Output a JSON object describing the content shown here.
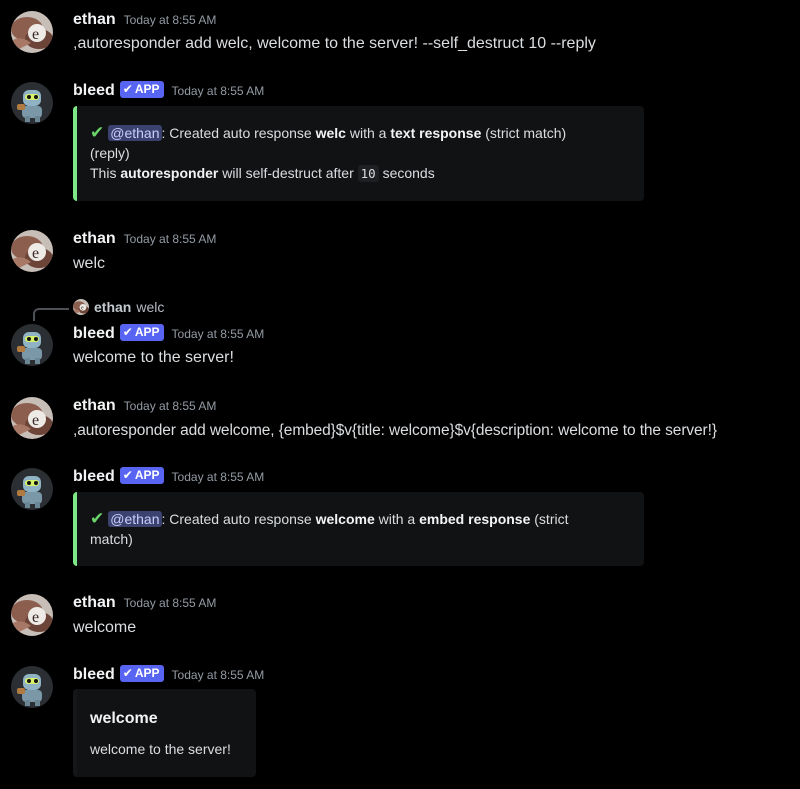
{
  "users": {
    "ethan": {
      "name": "ethan"
    },
    "bleed": {
      "name": "bleed",
      "badge": "APP"
    }
  },
  "messages": [
    {
      "author": "ethan",
      "time": "Today at 8:55 AM",
      "text": ",autoresponder add welc, welcome to the server! --self_destruct 10 --reply"
    },
    {
      "author": "bleed",
      "time": "Today at 8:55 AM",
      "embed": {
        "mention": "@ethan",
        "line1_a": ": Created auto response ",
        "line1_b": "welc",
        "line1_c": " with a ",
        "line1_d": "text response",
        "line1_e": " (strict match)",
        "line2": "(reply)",
        "line3_a": "This ",
        "line3_b": "autoresponder",
        "line3_c": " will self-destruct after ",
        "line3_d": "10",
        "line3_e": " seconds"
      }
    },
    {
      "author": "ethan",
      "time": "Today at 8:55 AM",
      "text": "welc"
    },
    {
      "author": "bleed",
      "time": "Today at 8:55 AM",
      "reply_to": {
        "name": "ethan",
        "text": "welc"
      },
      "text": "welcome to the server!"
    },
    {
      "author": "ethan",
      "time": "Today at 8:55 AM",
      "text": ",autoresponder add welcome, {embed}$v{title: welcome}$v{description: welcome to the server!}"
    },
    {
      "author": "bleed",
      "time": "Today at 8:55 AM",
      "embed": {
        "mention": "@ethan",
        "line1_a": ": Created auto response ",
        "line1_b": "welcome",
        "line1_c": " with a ",
        "line1_d": "embed response",
        "line1_e": " (strict",
        "line2": "match)"
      }
    },
    {
      "author": "ethan",
      "time": "Today at 8:55 AM",
      "text": "welcome"
    },
    {
      "author": "bleed",
      "time": "Today at 8:55 AM",
      "embed": {
        "title": "welcome",
        "description": "welcome to the server!"
      }
    }
  ],
  "colors": {
    "accent_success": "#7ee787",
    "badge": "#5865f2",
    "mention_bg": "#3c4270"
  },
  "icons": {
    "check": "checkmark-icon",
    "badge_check": "verified-check-icon"
  }
}
